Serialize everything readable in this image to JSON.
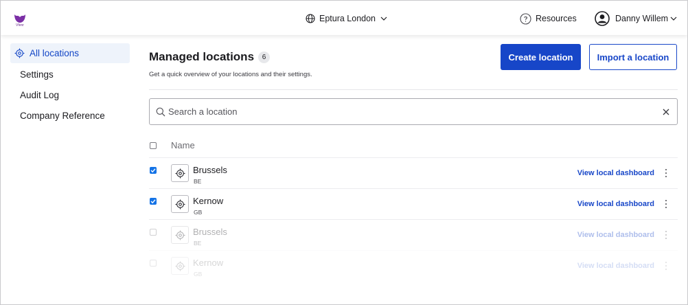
{
  "brand": {
    "logo_text": "Vfenr",
    "color": "#7b2fa6"
  },
  "header": {
    "location_switcher": "Eptura London",
    "resources": "Resources",
    "user_name": "Danny Willem"
  },
  "sidebar": {
    "items": [
      {
        "label": "All locations",
        "active": true
      },
      {
        "label": "Settings"
      },
      {
        "label": "Audit Log"
      },
      {
        "label": "Company Reference"
      }
    ]
  },
  "main": {
    "title": "Managed locations",
    "count": "6",
    "subtitle": "Get a quick overview of your locations and their settings.",
    "create_button": "Create location",
    "import_button": "Import a location",
    "search": {
      "placeholder": "Search a location",
      "value": ""
    },
    "table": {
      "header_name": "Name",
      "rows": [
        {
          "name": "Brussels",
          "code": "BE",
          "link": "View local dashboard",
          "checked": true
        },
        {
          "name": "Kernow",
          "code": "GB",
          "link": "View local dashboard",
          "checked": true
        },
        {
          "name": "Brussels",
          "code": "BE",
          "link": "View local dashboard",
          "checked": false
        },
        {
          "name": "Kernow",
          "code": "GB",
          "link": "View local dashboard",
          "checked": false
        }
      ]
    }
  },
  "colors": {
    "primary": "#1746c8",
    "checkbox": "#1473e6",
    "active_bg": "#eef3fb"
  },
  "icons": [
    "globe-icon",
    "chevron-down-icon",
    "help-circle-icon",
    "user-avatar-icon",
    "target-icon",
    "search-icon",
    "close-icon",
    "kebab-menu-icon",
    "checkbox-icon"
  ]
}
